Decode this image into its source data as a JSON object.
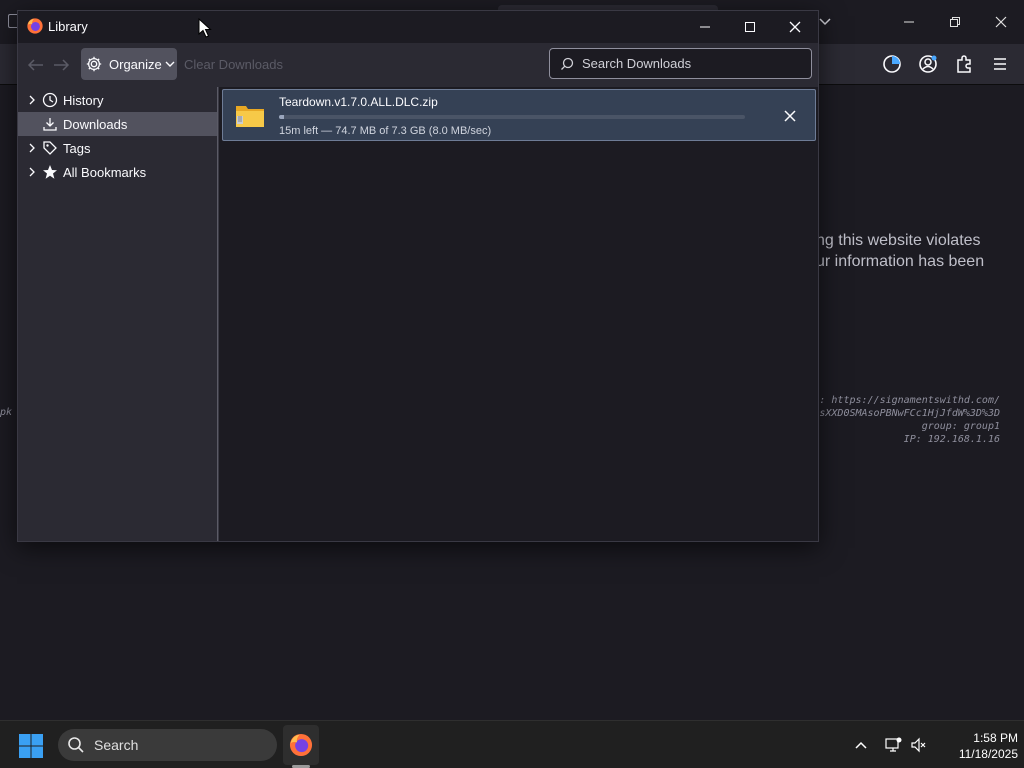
{
  "background_browser": {
    "visible_message": [
      "ng this website violates",
      "ur information has been"
    ],
    "info_lines": [
      ": https://signamentswithd.com/",
      "sXXD0SMAsoPBNwFCc1HjJfdW%3D%3D",
      "group: group1",
      "IP: 192.168.1.16"
    ],
    "left_fragment": "pk"
  },
  "library": {
    "title": "Library",
    "toolbar": {
      "organize_label": "Organize",
      "clear_downloads_label": "Clear Downloads",
      "search_placeholder": "Search Downloads"
    },
    "sidebar": {
      "items": [
        {
          "label": "History",
          "icon": "clock-icon",
          "expandable": true,
          "selected": false
        },
        {
          "label": "Downloads",
          "icon": "download-icon",
          "expandable": false,
          "selected": true
        },
        {
          "label": "Tags",
          "icon": "tag-icon",
          "expandable": true,
          "selected": false
        },
        {
          "label": "All Bookmarks",
          "icon": "star-icon",
          "expandable": true,
          "selected": false
        }
      ]
    },
    "downloads": [
      {
        "filename": "Teardown.v1.7.0.ALL.DLC.zip",
        "status": "15m left — 74.7 MB of 7.3 GB (8.0 MB/sec)",
        "progress_fraction": 0.01,
        "icon": "zip-folder-icon"
      }
    ]
  },
  "taskbar": {
    "search_label": "Search",
    "time": "1:58 PM",
    "date": "11/18/2025"
  },
  "colors": {
    "accent": "#0078d4",
    "selected_row": "#354155",
    "firefox_orange": "#ff7139"
  }
}
